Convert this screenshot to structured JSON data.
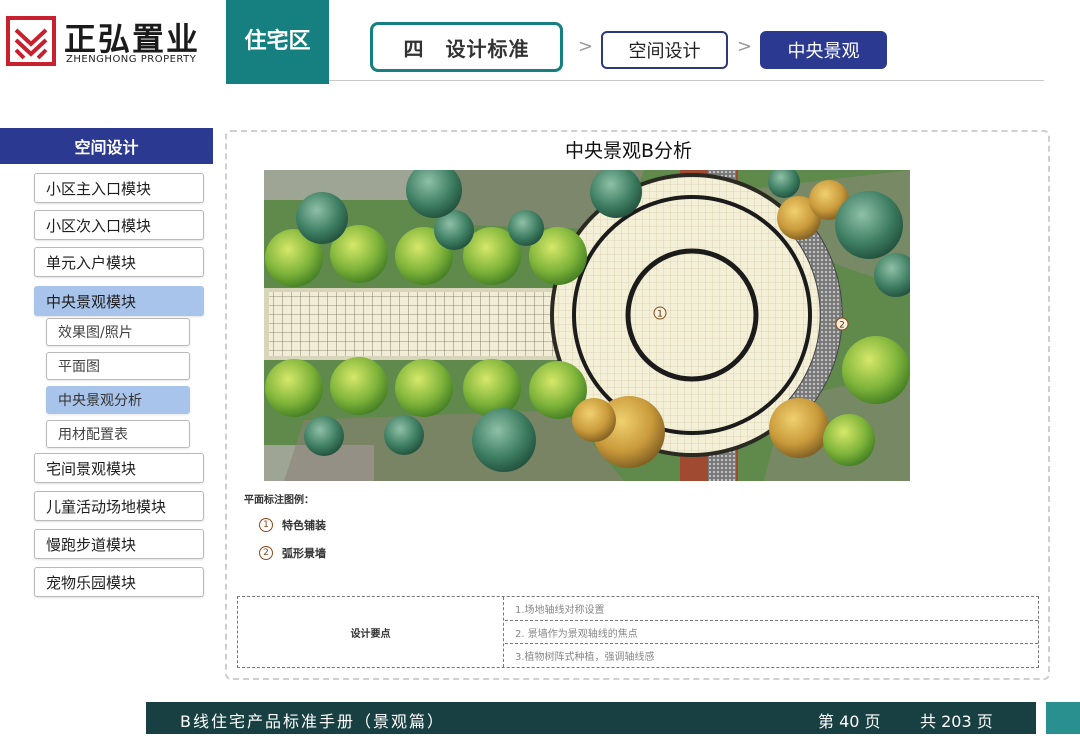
{
  "header": {
    "logo_cn": "正弘置业",
    "logo_en": "ZHENGHONG PROPERTY",
    "section_tab": "住宅区",
    "breadcrumb": [
      "四　设计标准",
      "空间设计",
      "中央景观"
    ],
    "arrow": ">"
  },
  "sidebar": {
    "title": "空间设计",
    "items": [
      {
        "label": "小区主入口模块"
      },
      {
        "label": "小区次入口模块"
      },
      {
        "label": "单元入户模块"
      },
      {
        "label": "中央景观模块"
      },
      {
        "label": "宅间景观模块"
      },
      {
        "label": "儿童活动场地模块"
      },
      {
        "label": "慢跑步道模块"
      },
      {
        "label": "宠物乐园模块"
      }
    ],
    "active_item": "中央景观模块",
    "subitems": [
      {
        "label": "效果图/照片"
      },
      {
        "label": "平面图"
      },
      {
        "label": "中央景观分析"
      },
      {
        "label": "用材配置表"
      }
    ],
    "active_subitem": "中央景观分析"
  },
  "main": {
    "plan_title": "中央景观B分析",
    "plan_markers": [
      "1",
      "2"
    ],
    "legend_title": "平面标注图例：",
    "legend": [
      {
        "num": "1",
        "label": "特色铺装"
      },
      {
        "num": "2",
        "label": "弧形景墙"
      }
    ],
    "requirements": {
      "header": "设计要点",
      "rows": [
        "1.场地轴线对称设置",
        "2. 景墙作为景观轴线的焦点",
        "3.植物树阵式种植，强调轴线感"
      ]
    }
  },
  "footer": {
    "title": "B线住宅产品标准手册（景观篇）",
    "page": "第 40 页",
    "total": "共 203 页"
  },
  "colors": {
    "teal": "#167f80",
    "navy": "#2b3990",
    "highlight": "#a9c4ea",
    "footer_bg": "#183f41",
    "marker": "#8a4a1c"
  }
}
